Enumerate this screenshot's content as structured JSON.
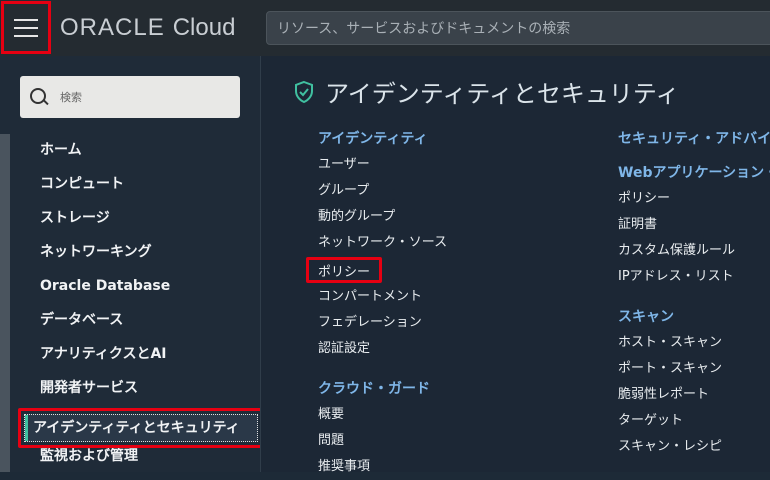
{
  "topbar": {
    "logo_brand": "ORACLE",
    "logo_product": "Cloud",
    "search_placeholder": "リソース、サービスおよびドキュメントの検索"
  },
  "sidebar": {
    "search_placeholder": "検索",
    "items": [
      {
        "label": "ホーム"
      },
      {
        "label": "コンピュート"
      },
      {
        "label": "ストレージ"
      },
      {
        "label": "ネットワーキング"
      },
      {
        "label": "Oracle Database"
      },
      {
        "label": "データベース"
      },
      {
        "label": "アナリティクスとAI"
      },
      {
        "label": "開発者サービス"
      },
      {
        "label": "アイデンティティとセキュリティ"
      },
      {
        "label": "監視および管理"
      }
    ]
  },
  "main": {
    "title": "アイデンティティとセキュリティ",
    "column1": {
      "identity": {
        "heading": "アイデンティティ",
        "links": [
          "ユーザー",
          "グループ",
          "動的グループ",
          "ネットワーク・ソース",
          "ポリシー",
          "コンパートメント",
          "フェデレーション",
          "認証設定"
        ]
      },
      "cloud_guard": {
        "heading": "クラウド・ガード",
        "links": [
          "概要",
          "問題",
          "推奨事項"
        ]
      }
    },
    "column2": {
      "security_advisor": {
        "heading": "セキュリティ・アドバイザ"
      },
      "waf": {
        "heading": "Webアプリケーション・ファイアウォール",
        "links": [
          "ポリシー",
          "証明書",
          "カスタム保護ルール",
          "IPアドレス・リスト"
        ]
      },
      "scanning": {
        "heading": "スキャン",
        "links": [
          "ホスト・スキャン",
          "ポート・スキャン",
          "脆弱性レポート",
          "ターゲット",
          "スキャン・レシピ"
        ]
      }
    }
  },
  "colors": {
    "highlight": "#e60012",
    "heading": "#7fb6e8",
    "accent": "#40c0a0"
  }
}
